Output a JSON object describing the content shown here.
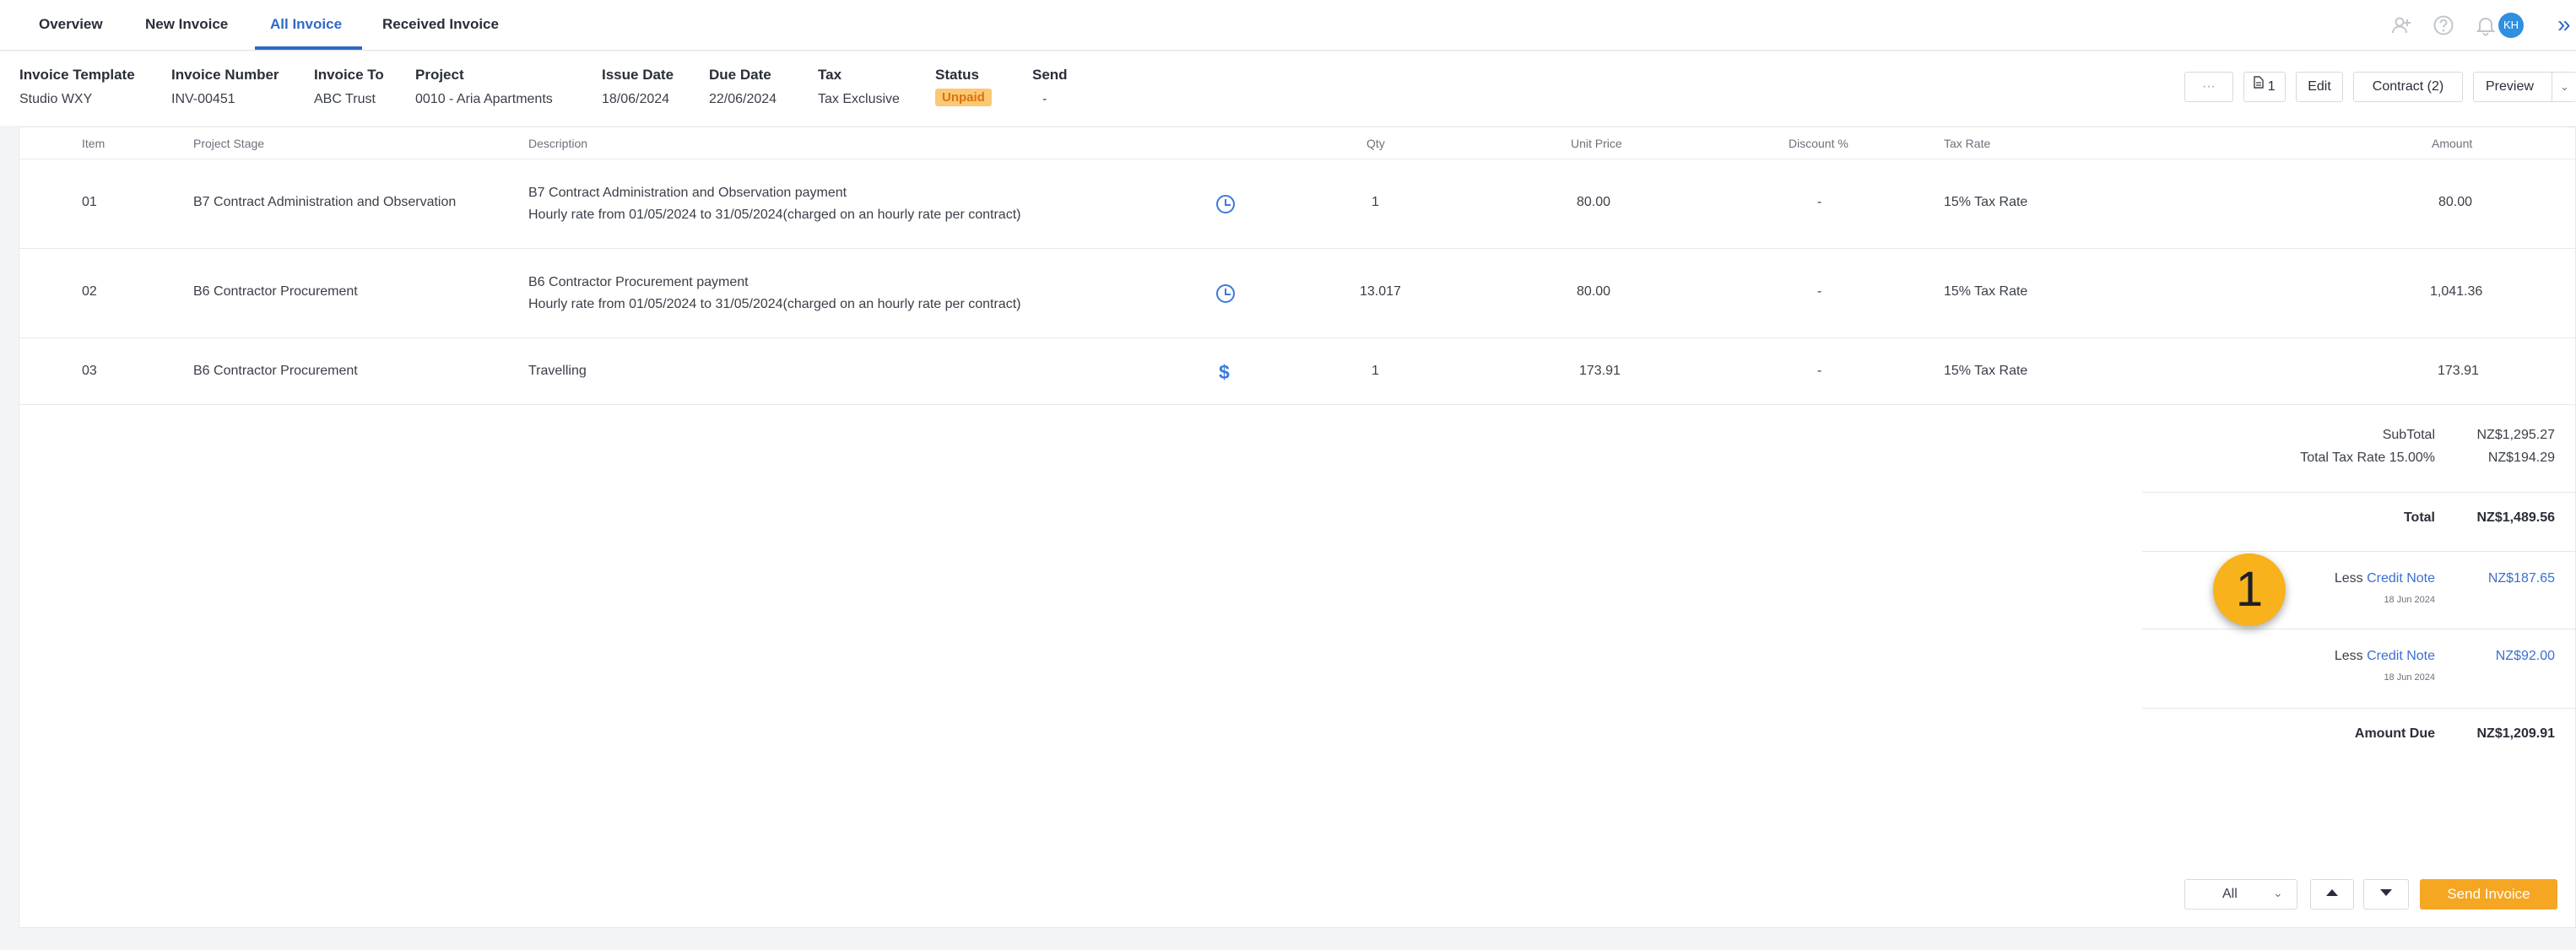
{
  "nav": {
    "tabs": [
      {
        "label": "Overview"
      },
      {
        "label": "New Invoice"
      },
      {
        "label": "All Invoice"
      },
      {
        "label": "Received Invoice"
      }
    ],
    "active_tab": "All Invoice",
    "icons": [
      "add-user-icon",
      "help-icon",
      "bell-icon"
    ],
    "avatar_initials": "KH",
    "expand_glyph": "»"
  },
  "invoice_header": {
    "fields": [
      {
        "label": "Invoice Template",
        "value": "Studio WXY"
      },
      {
        "label": "Invoice Number",
        "value": "INV-00451"
      },
      {
        "label": "Invoice To",
        "value": "ABC Trust"
      },
      {
        "label": "Project",
        "value": "0010 - Aria Apartments"
      },
      {
        "label": "Issue Date",
        "value": "18/06/2024"
      },
      {
        "label": "Due Date",
        "value": "22/06/2024"
      },
      {
        "label": "Tax",
        "value": "Tax Exclusive"
      },
      {
        "label": "Status",
        "value": "Unpaid"
      },
      {
        "label": "Send",
        "value": "-"
      }
    ],
    "buttons": {
      "more": "···",
      "attachments": "1",
      "edit": "Edit",
      "contract": "Contract (2)",
      "preview": "Preview"
    }
  },
  "table": {
    "columns": [
      "Item",
      "Project Stage",
      "Description",
      "Qty",
      "Unit Price",
      "Discount %",
      "Tax Rate",
      "Amount"
    ],
    "rows": [
      {
        "item": "01",
        "stage": "B7 Contract Administration and Observation",
        "description": [
          "B7 Contract Administration and Observation payment",
          "Hourly rate  from 01/05/2024 to 31/05/2024(charged on an hourly rate per contract)"
        ],
        "icon": "clock-icon",
        "qty": "1",
        "unit_price": "80.00",
        "discount": "-",
        "tax_rate": "15% Tax Rate",
        "amount": "80.00"
      },
      {
        "item": "02",
        "stage": "B6 Contractor Procurement",
        "description": [
          "B6 Contractor Procurement payment",
          "Hourly rate  from 01/05/2024 to 31/05/2024(charged on an hourly rate per contract)"
        ],
        "icon": "clock-icon",
        "qty": "13.017",
        "unit_price": "80.00",
        "discount": "-",
        "tax_rate": "15% Tax Rate",
        "amount": "1,041.36"
      },
      {
        "item": "03",
        "stage": "B6 Contractor Procurement",
        "description": [
          "Travelling"
        ],
        "icon": "dollar-icon",
        "icon_glyph": "$",
        "qty": "1",
        "unit_price": "173.91",
        "discount": "-",
        "tax_rate": "15% Tax Rate",
        "amount": "173.91"
      }
    ]
  },
  "totals": {
    "subtotal_label": "SubTotal",
    "subtotal_value": "NZ$1,295.27",
    "tax_label": "Total Tax Rate 15.00%",
    "tax_value": "NZ$194.29",
    "total_label": "Total",
    "total_value": "NZ$1,489.56",
    "credits": [
      {
        "prefix": "Less",
        "link": "Credit Note",
        "date": "18 Jun 2024",
        "value": "NZ$187.65"
      },
      {
        "prefix": "Less",
        "link": "Credit Note",
        "date": "18 Jun 2024",
        "value": "NZ$92.00"
      }
    ],
    "amount_due_label": "Amount Due",
    "amount_due_value": "NZ$1,209.91"
  },
  "annotation_marker": "1",
  "footer": {
    "filter_value": "All",
    "send_label": "Send Invoice"
  },
  "colors": {
    "accent": "#2f69c8",
    "status_unpaid_bg": "#fbc973",
    "status_unpaid_text": "#d9720f",
    "send_button": "#f5a623",
    "marker": "#f7b21c"
  }
}
